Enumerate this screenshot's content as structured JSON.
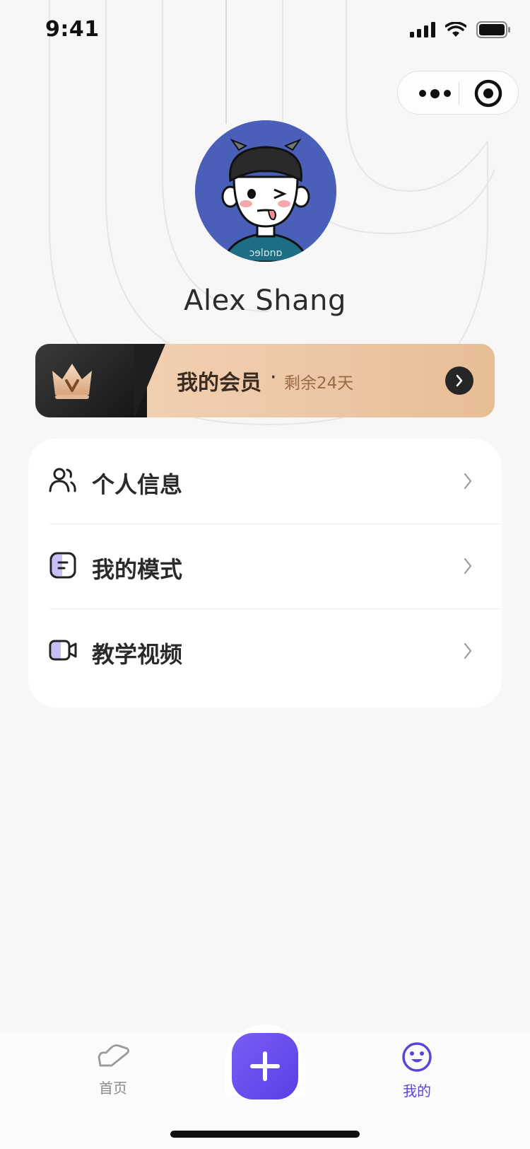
{
  "status_bar": {
    "time": "9:41"
  },
  "profile": {
    "name": "Alex Shang"
  },
  "membership": {
    "title": "我的会员",
    "separator": "·",
    "remaining": "剩余24天"
  },
  "menu": {
    "items": [
      {
        "label": "个人信息",
        "icon": "person-icon"
      },
      {
        "label": "我的模式",
        "icon": "mode-icon"
      },
      {
        "label": "教学视频",
        "icon": "video-icon"
      }
    ]
  },
  "tabbar": {
    "items": [
      {
        "label": "首页",
        "icon": "shoe-icon"
      },
      {
        "label": "我的",
        "icon": "face-icon"
      }
    ],
    "active_color": "#5a46d6",
    "center_icon": "plus-icon"
  },
  "colors": {
    "accent": "#5a46d6",
    "member_gold": "#efcbab"
  }
}
